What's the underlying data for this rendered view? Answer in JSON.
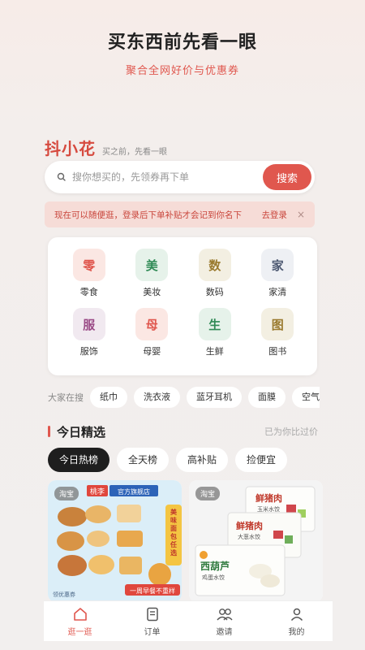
{
  "hero": {
    "title": "买东西前先看一眼",
    "subtitle": "聚合全网好价与优惠券"
  },
  "brand": {
    "name": "抖小花",
    "slogan": "买之前，先看一眼"
  },
  "search": {
    "placeholder": "搜你想买的，先领券再下单",
    "button": "搜索"
  },
  "login_banner": {
    "text": "现在可以随便逛，登录后下单补贴才会记到你名下",
    "link": "去登录",
    "close": "×"
  },
  "categories": [
    {
      "icon_char": "零",
      "label": "零食",
      "bg": "#fbe7e3",
      "fg": "#e0574e"
    },
    {
      "icon_char": "美",
      "label": "美妆",
      "bg": "#e6f2ea",
      "fg": "#2f8a55"
    },
    {
      "icon_char": "数",
      "label": "数码",
      "bg": "#f3efe2",
      "fg": "#9a7a2e"
    },
    {
      "icon_char": "家",
      "label": "家清",
      "bg": "#eef0f4",
      "fg": "#4e5a72"
    },
    {
      "icon_char": "服",
      "label": "服饰",
      "bg": "#f1e9f0",
      "fg": "#9a4a86"
    },
    {
      "icon_char": "母",
      "label": "母婴",
      "bg": "#fbe7e3",
      "fg": "#e0574e"
    },
    {
      "icon_char": "生",
      "label": "生鲜",
      "bg": "#e6f2ea",
      "fg": "#2f8a55"
    },
    {
      "icon_char": "图",
      "label": "图书",
      "bg": "#f3efe2",
      "fg": "#9a7a2e"
    }
  ],
  "hot_search": {
    "label": "大家在搜",
    "chips": [
      "纸巾",
      "洗衣液",
      "蓝牙耳机",
      "面膜",
      "空气炸"
    ]
  },
  "section": {
    "title": "今日精选",
    "note": "已为你比过价"
  },
  "tabs": [
    {
      "label": "今日热榜",
      "active": true
    },
    {
      "label": "全天榜",
      "active": false
    },
    {
      "label": "高补贴",
      "active": false
    },
    {
      "label": "捡便宜",
      "active": false
    }
  ],
  "products": [
    {
      "platform": "淘宝",
      "store_badge": "桃李",
      "store_name": "官方旗舰店",
      "promo": "美味面包任选",
      "footer": "一周早餐不重样",
      "corner": "领优惠券"
    },
    {
      "platform": "淘宝",
      "pack_1_top": "鲜猪肉",
      "pack_1_sub": "玉米水饺",
      "pack_2_top": "鲜猪肉",
      "pack_2_sub": "大葱水饺",
      "pack_3_top": "西葫芦",
      "pack_3_sub": "鸡蛋水饺"
    }
  ],
  "nav": [
    {
      "label": "逛一逛",
      "icon": "home-icon",
      "active": true
    },
    {
      "label": "订单",
      "icon": "order-icon",
      "active": false
    },
    {
      "label": "邀请",
      "icon": "invite-icon",
      "active": false
    },
    {
      "label": "我的",
      "icon": "profile-icon",
      "active": false
    }
  ],
  "colors": {
    "accent": "#e0574e",
    "banner_bg": "#f6dcd7",
    "active_tab": "#1e1e1e"
  }
}
